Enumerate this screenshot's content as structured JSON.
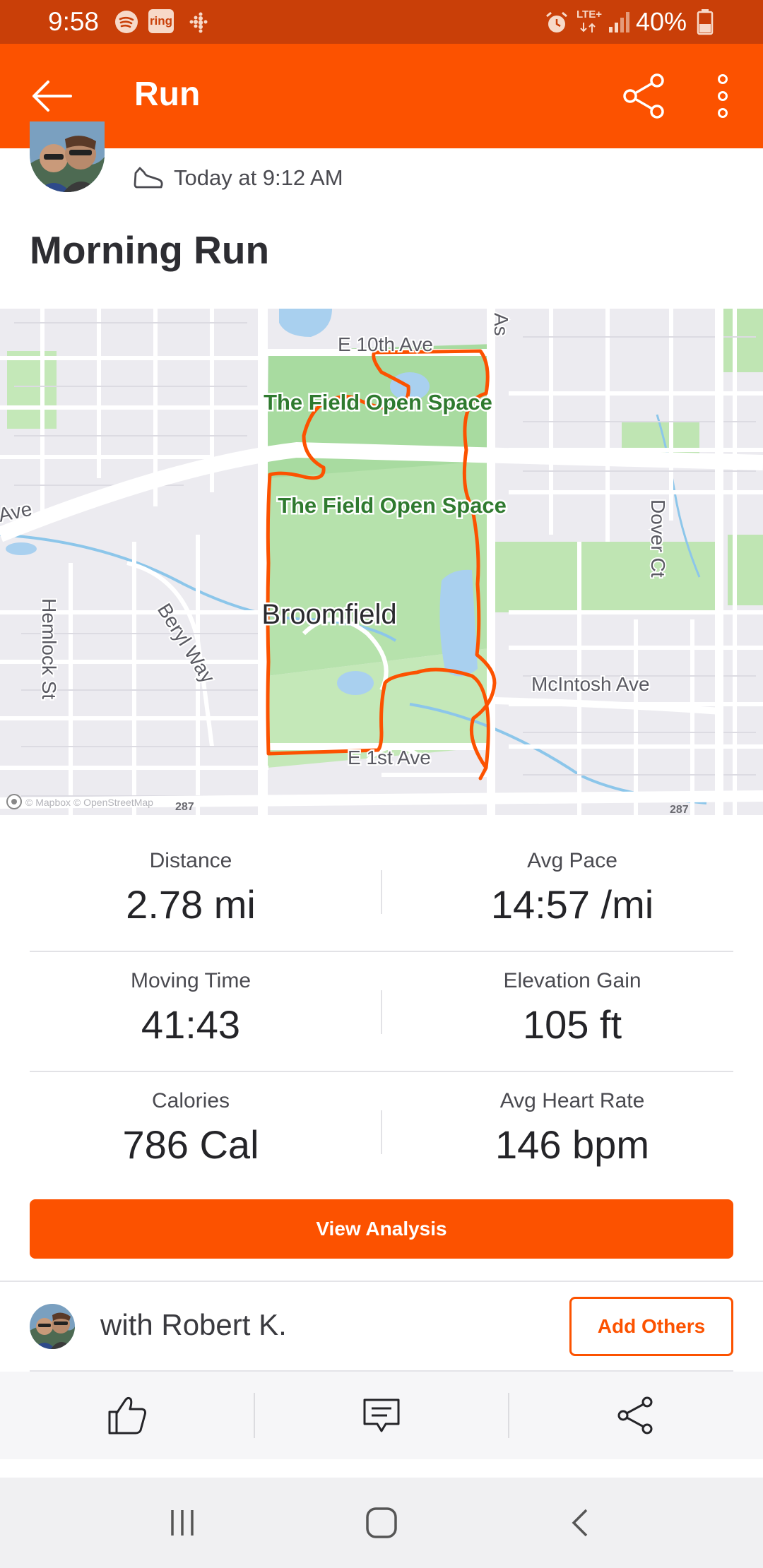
{
  "status_bar": {
    "time": "9:58",
    "ring_label": "ring",
    "network": "LTE+",
    "battery": "40%",
    "notification_icons": [
      "spotify-icon",
      "ring-icon",
      "fitbit-icon"
    ],
    "system_icons": [
      "alarm-icon",
      "network-icon",
      "signal-icon",
      "battery-icon"
    ]
  },
  "app_bar": {
    "title": "Run",
    "icons": [
      "back-arrow-icon",
      "share-icon",
      "more-vertical-icon"
    ]
  },
  "activity": {
    "time": "Today at 9:12 AM",
    "title": "Morning Run",
    "type_icon": "shoe-icon"
  },
  "map": {
    "labels": {
      "park_north": "The Field Open Space",
      "park_south": "The Field Open Space",
      "city": "Broomfield",
      "street_e10th": "E 10th Ave",
      "street_e1st": "E 1st Ave",
      "street_mcintosh": "McIntosh Ave",
      "street_dover": "Dover Ct",
      "street_hemlock": "Hemlock St",
      "street_beryl": "Beryl Way",
      "street_ave_left": "Ave",
      "street_as": "As",
      "hwy_1": "287",
      "hwy_2": "287",
      "attribution": "© Mapbox © OpenStreetMap"
    },
    "route_color": "#fc5200"
  },
  "stats": [
    {
      "label": "Distance",
      "value": "2.78 mi"
    },
    {
      "label": "Avg Pace",
      "value": "14:57 /mi"
    },
    {
      "label": "Moving Time",
      "value": "41:43"
    },
    {
      "label": "Elevation Gain",
      "value": "105 ft"
    },
    {
      "label": "Calories",
      "value": "786 Cal"
    },
    {
      "label": "Avg Heart Rate",
      "value": "146 bpm"
    }
  ],
  "buttons": {
    "view_analysis": "View Analysis",
    "add_others": "Add Others"
  },
  "with": {
    "text": "with Robert K."
  },
  "actions": [
    "like-icon",
    "comment-icon",
    "share-icon"
  ],
  "nav": [
    "recent-apps-icon",
    "home-icon",
    "back-icon"
  ],
  "colors": {
    "brand": "#fc5200",
    "status_bar": "#c93f08",
    "park": "#a8dba0",
    "water": "#a9d0ef"
  }
}
